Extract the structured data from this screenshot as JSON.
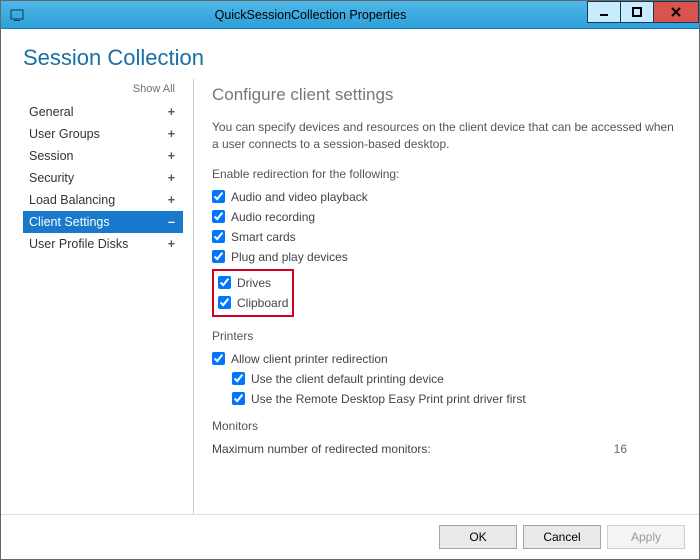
{
  "window": {
    "title": "QuickSessionCollection Properties"
  },
  "page": {
    "heading": "Session Collection",
    "show_all": "Show All"
  },
  "sidebar": {
    "items": [
      {
        "label": "General",
        "sym": "+",
        "selected": false
      },
      {
        "label": "User Groups",
        "sym": "+",
        "selected": false
      },
      {
        "label": "Session",
        "sym": "+",
        "selected": false
      },
      {
        "label": "Security",
        "sym": "+",
        "selected": false
      },
      {
        "label": "Load Balancing",
        "sym": "+",
        "selected": false
      },
      {
        "label": "Client Settings",
        "sym": "–",
        "selected": true
      },
      {
        "label": "User Profile Disks",
        "sym": "+",
        "selected": false
      }
    ]
  },
  "main": {
    "title": "Configure client settings",
    "description": "You can specify devices and resources on the client device that can be accessed when a user connects to a session-based desktop.",
    "enable_label": "Enable redirection for the following:",
    "checks": {
      "av": "Audio and video playback",
      "rec": "Audio recording",
      "smart": "Smart cards",
      "pnp": "Plug and play devices",
      "drives": "Drives",
      "clip": "Clipboard"
    },
    "printers_label": "Printers",
    "printers": {
      "redir": "Allow client printer redirection",
      "default": "Use the client default printing device",
      "easy": "Use the Remote Desktop Easy Print print driver first"
    },
    "monitors_label": "Monitors",
    "monitors_row": "Maximum number of redirected monitors:",
    "monitors_value": "16"
  },
  "footer": {
    "ok": "OK",
    "cancel": "Cancel",
    "apply": "Apply"
  }
}
